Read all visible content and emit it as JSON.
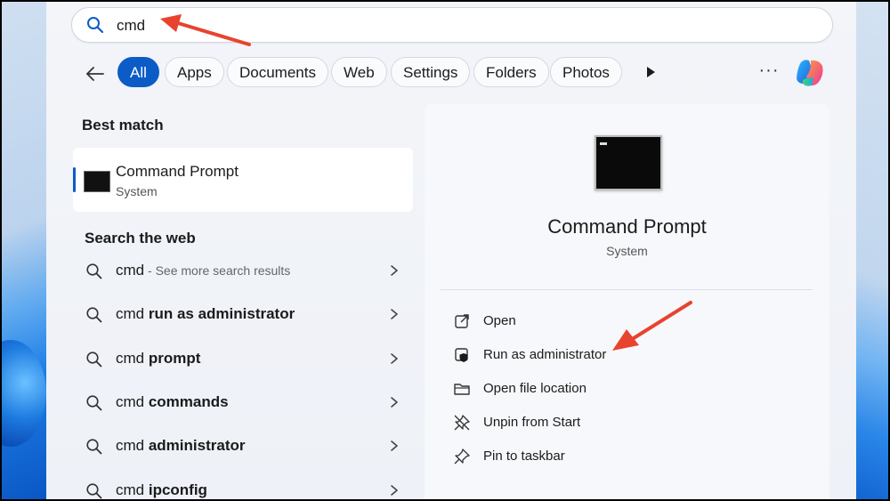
{
  "search": {
    "value": "cmd",
    "icon": "search-icon"
  },
  "filters": {
    "back_icon": "back-arrow-icon",
    "chips": [
      "All",
      "Apps",
      "Documents",
      "Web",
      "Settings",
      "Folders",
      "Photos"
    ],
    "more": "···"
  },
  "best_match": {
    "heading": "Best match",
    "title": "Command Prompt",
    "subtitle": "System"
  },
  "web": {
    "heading": "Search the web",
    "items": [
      {
        "plain": "cmd",
        "bold": "",
        "hint": " - See more search results"
      },
      {
        "plain": "cmd ",
        "bold": "run as administrator",
        "hint": ""
      },
      {
        "plain": "cmd ",
        "bold": "prompt",
        "hint": ""
      },
      {
        "plain": "cmd ",
        "bold": "commands",
        "hint": ""
      },
      {
        "plain": "cmd ",
        "bold": "administrator",
        "hint": ""
      },
      {
        "plain": "cmd ",
        "bold": "ipconfig",
        "hint": ""
      }
    ]
  },
  "preview": {
    "title": "Command Prompt",
    "subtitle": "System",
    "actions": [
      {
        "label": "Open",
        "icon": "open-external-icon"
      },
      {
        "label": "Run as administrator",
        "icon": "shield-icon"
      },
      {
        "label": "Open file location",
        "icon": "folder-icon"
      },
      {
        "label": "Unpin from Start",
        "icon": "unpin-icon"
      },
      {
        "label": "Pin to taskbar",
        "icon": "pin-icon"
      }
    ]
  },
  "colors": {
    "accent": "#0b5cc7",
    "annotation_arrow": "#e8432f"
  }
}
